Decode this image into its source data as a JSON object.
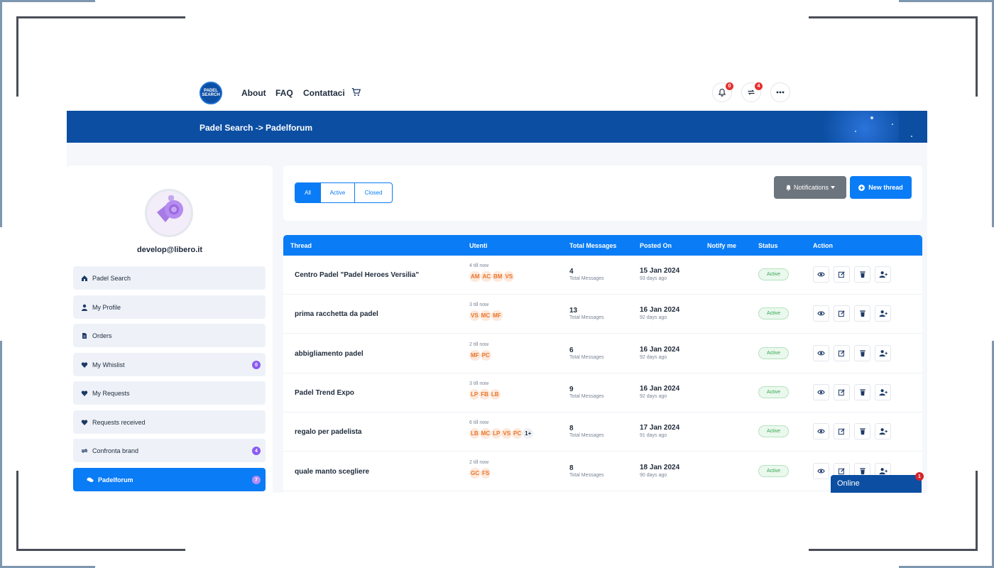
{
  "header": {
    "logo_text": "PADEL SEARCH",
    "nav": [
      "About",
      "FAQ",
      "Contattaci"
    ],
    "notifications_count": "0",
    "compare_count": "4"
  },
  "banner": {
    "breadcrumb": "Padel Search -> Padelforum"
  },
  "sidebar": {
    "email": "develop@libero.it",
    "items": [
      {
        "label": "Padel Search",
        "icon": "home-icon"
      },
      {
        "label": "My Profile",
        "icon": "user-icon"
      },
      {
        "label": "Orders",
        "icon": "document-icon"
      },
      {
        "label": "My Whislist",
        "icon": "heart-icon",
        "count": "0"
      },
      {
        "label": "My Requests",
        "icon": "heart-icon"
      },
      {
        "label": "Requests received",
        "icon": "heart-icon"
      },
      {
        "label": "Confronta brand",
        "icon": "repeat-icon",
        "count": "4"
      },
      {
        "label": "Padelforum",
        "icon": "chat-icon",
        "count": "7"
      }
    ]
  },
  "filters": {
    "tabs": [
      "All",
      "Active",
      "Closed"
    ],
    "notifications_label": "Notifications",
    "new_thread_label": "New thread"
  },
  "table": {
    "headers": [
      "Thread",
      "Utenti",
      "Total Messages",
      "Posted On",
      "Notify me",
      "Status",
      "Action"
    ],
    "rows": [
      {
        "title": "Centro Padel \"Padel Heroes Versilia\"",
        "till": "4 till now",
        "users": [
          "AM",
          "AC",
          "BM",
          "VS"
        ],
        "more": "",
        "messages": "4",
        "messages_label": "Total Messages",
        "date": "15 Jan 2024",
        "ago": "93 days ago",
        "status": "Active"
      },
      {
        "title": "prima racchetta da padel",
        "till": "3 till now",
        "users": [
          "VS",
          "MC",
          "MF"
        ],
        "more": "",
        "messages": "13",
        "messages_label": "Total Messages",
        "date": "16 Jan 2024",
        "ago": "92 days ago",
        "status": "Active"
      },
      {
        "title": "abbigliamento padel",
        "till": "2 till now",
        "users": [
          "MF",
          "PC"
        ],
        "more": "",
        "messages": "6",
        "messages_label": "Total Messages",
        "date": "16 Jan 2024",
        "ago": "92 days ago",
        "status": "Active"
      },
      {
        "title": "Padel Trend Expo",
        "till": "3 till now",
        "users": [
          "LP",
          "FB",
          "LB"
        ],
        "more": "",
        "messages": "9",
        "messages_label": "Total Messages",
        "date": "16 Jan 2024",
        "ago": "92 days ago",
        "status": "Active"
      },
      {
        "title": "regalo per padelista",
        "till": "6 till now",
        "users": [
          "LB",
          "MC",
          "LP",
          "VS",
          "PC"
        ],
        "more": "1+",
        "messages": "8",
        "messages_label": "Total Messages",
        "date": "17 Jan 2024",
        "ago": "91 days ago",
        "status": "Active"
      },
      {
        "title": "quale manto scegliere",
        "till": "2 till now",
        "users": [
          "GC",
          "FS"
        ],
        "more": "",
        "messages": "8",
        "messages_label": "Total Messages",
        "date": "18 Jan 2024",
        "ago": "90 days ago",
        "status": "Active"
      }
    ]
  },
  "chat": {
    "label": "Online",
    "badge": "1"
  },
  "colors": {
    "primary": "#0a7cf5",
    "banner": "#0b4ea2",
    "badge_purple": "#8a5cf0",
    "badge_red": "#e5312f"
  }
}
